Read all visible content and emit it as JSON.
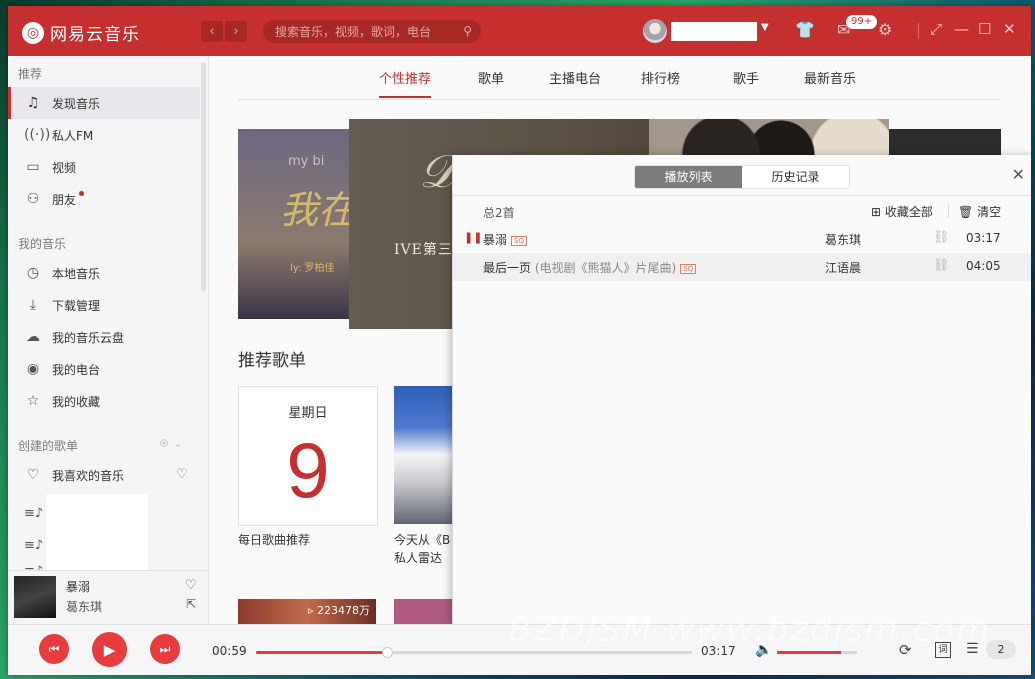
{
  "app": {
    "name": "网易云音乐"
  },
  "titlebar": {
    "search_placeholder": "搜索音乐，视频，歌词，电台",
    "message_badge": "99+"
  },
  "sidebar": {
    "section_recommend": "推荐",
    "recommend_items": [
      {
        "label": "发现音乐",
        "icon": "music-note-icon"
      },
      {
        "label": "私人FM",
        "icon": "radio-waves-icon"
      },
      {
        "label": "视频",
        "icon": "video-icon"
      },
      {
        "label": "朋友",
        "icon": "friends-icon"
      }
    ],
    "section_mymusic": "我的音乐",
    "mymusic_items": [
      {
        "label": "本地音乐",
        "icon": "clock-icon"
      },
      {
        "label": "下载管理",
        "icon": "download-icon"
      },
      {
        "label": "我的音乐云盘",
        "icon": "cloud-icon"
      },
      {
        "label": "我的电台",
        "icon": "podcast-icon"
      },
      {
        "label": "我的收藏",
        "icon": "collection-icon"
      }
    ],
    "section_created": "创建的歌单",
    "liked_music": "我喜欢的音乐"
  },
  "mini_player": {
    "title": "暴溺",
    "artist": "葛东琪"
  },
  "main": {
    "tabs": [
      "个性推荐",
      "歌单",
      "主播电台",
      "排行榜",
      "歌手",
      "最新音乐"
    ],
    "banner_left_text": "my bi",
    "banner_left_script": "我在",
    "banner_left_small": "ly: 罗柏佳",
    "banner_text": "IVE第三",
    "section_title": "推荐歌单",
    "daily_card_day": "星期日",
    "daily_card_num": "9",
    "daily_card_caption": "每日歌曲推荐",
    "card2_caption_line1": "今天从《B",
    "card2_caption_line2": "私人雷达",
    "row2_play_count": "223478万"
  },
  "playlist_panel": {
    "tab_playlist": "播放列表",
    "tab_history": "历史记录",
    "total": "总2首",
    "collect_all": "收藏全部",
    "clear": "清空",
    "songs": [
      {
        "name": "暴溺",
        "sub": "",
        "artist": "葛东琪",
        "duration": "03:17",
        "playing": true
      },
      {
        "name": "最后一页",
        "sub": "(电视剧《熊猫人》片尾曲)",
        "artist": "江语晨",
        "duration": "04:05",
        "playing": false
      }
    ],
    "hq_label": "SQ"
  },
  "player": {
    "elapsed": "00:59",
    "total": "03:17",
    "progress": 0.3,
    "volume": 0.8,
    "lyric_label": "词",
    "queue_count": "2"
  },
  "watermark": "BZDJSM www.bzdjsm.com"
}
